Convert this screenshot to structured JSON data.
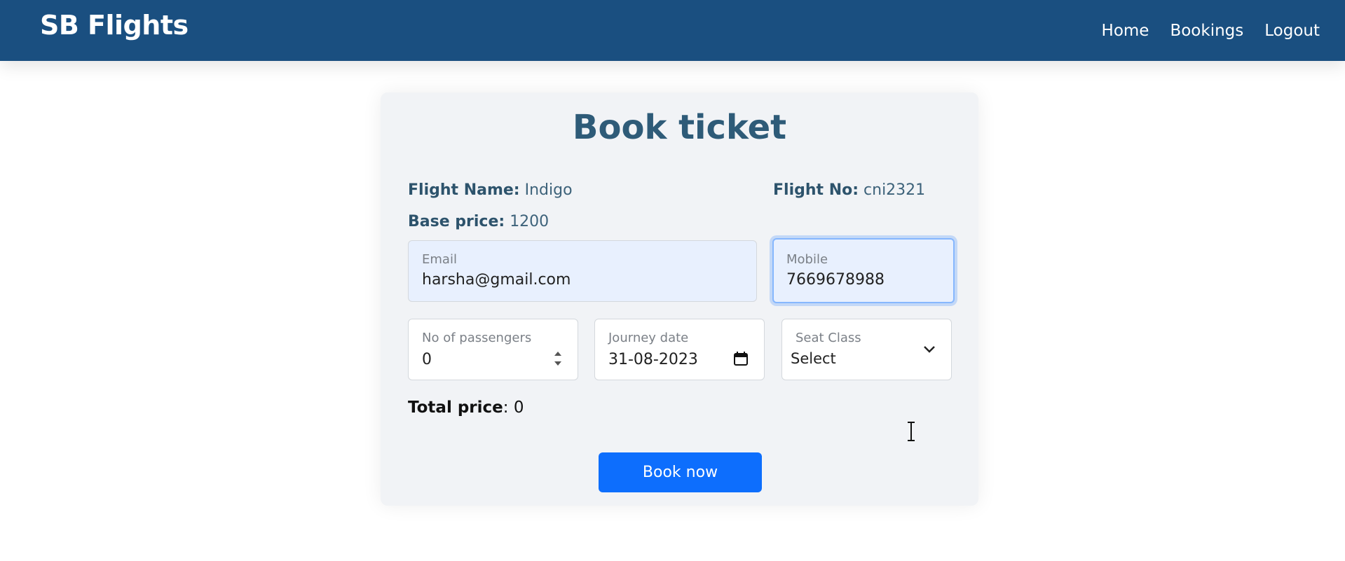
{
  "navbar": {
    "brand": "SB Flights",
    "links": [
      "Home",
      "Bookings",
      "Logout"
    ],
    "background": "#1a4f80"
  },
  "card": {
    "title": "Book ticket",
    "flight_name_label": "Flight Name:",
    "flight_name": "Indigo",
    "flight_no_label": "Flight No:",
    "flight_no": "cni2321",
    "base_price_label": "Base price:",
    "base_price": "1200",
    "email": {
      "label": "Email",
      "value": "harsha@gmail.com"
    },
    "mobile": {
      "label": "Mobile",
      "value": "7669678988"
    },
    "passengers": {
      "label": "No of passengers",
      "value": "0"
    },
    "journey_date": {
      "label": "Journey date",
      "value": "31-08-2023"
    },
    "seat_class": {
      "label": "Seat Class",
      "value": "Select"
    },
    "total_price_label": "Total price",
    "total_price": "0",
    "book_button": "Book now"
  },
  "colors": {
    "accent": "#0d6efd",
    "title": "#2e5b78",
    "autofill": "#e8f0fe"
  }
}
